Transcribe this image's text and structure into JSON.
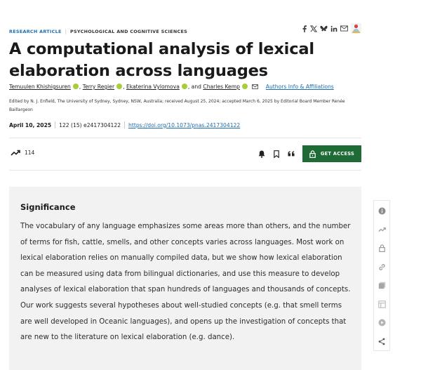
{
  "header": {
    "article_type": "RESEARCH ARTICLE",
    "subject": "PSYCHOLOGICAL AND COGNITIVE SCIENCES"
  },
  "title": "A computational analysis of lexical elaboration across languages",
  "authors": [
    {
      "name": "Temuulen Khishigsuren"
    },
    {
      "name": "Terry Regier"
    },
    {
      "name": "Ekaterina Vylomova"
    },
    {
      "name": "Charles Kemp"
    }
  ],
  "authors_sep": ",",
  "authors_and": ", and",
  "affiliations_link": "Authors Info & Affiliations",
  "edited_by": "Edited by N. J. Enfield, The University of Sydney, Sydney, NSW, Australia; received August 25, 2024; accepted March 6, 2025 by Editorial Board Member Renée Baillargeon",
  "publication": {
    "date": "April 10, 2025",
    "citation": "122 (15) e2417304122",
    "doi": "https://doi.org/10.1073/pnas.2417304122"
  },
  "metrics": {
    "count": "114"
  },
  "get_access_label": "GET ACCESS",
  "significance": {
    "heading": "Significance",
    "text": "The vocabulary of any language emphasizes some areas more than others, and the number of terms for fish, cattle, smells, and other concepts varies across languages. Most work on lexical elaboration relies on manually compiled data, but we show how lexical elaboration can be measured using data from bilingual dictionaries, and use this measure to develop analyses of lexical elaboration that span hundreds of languages and thousands of concepts. Our work suggests several hypotheses about well-studied concepts (e.g. that smell terms are well developed in Oceanic languages), and opens up the investigation of concepts that are new to the literature on lexical elaboration (e.g. dance)."
  },
  "colors": {
    "link": "#1a6db0",
    "orcid": "#a6ce39",
    "access_button": "#1e6b36",
    "significance_bg": "#f2f2f2"
  },
  "icons": {
    "share": [
      "facebook-icon",
      "x-icon",
      "bluesky-icon",
      "linkedin-icon",
      "email-icon",
      "mendeley-icon"
    ],
    "actions": [
      "alert-bell-icon",
      "bookmark-icon",
      "cite-quote-icon",
      "lock-icon"
    ],
    "sidebar": [
      "info-icon",
      "metrics-icon",
      "access-icon",
      "link-icon",
      "figures-icon",
      "tables-icon",
      "media-icon",
      "share-icon"
    ]
  }
}
